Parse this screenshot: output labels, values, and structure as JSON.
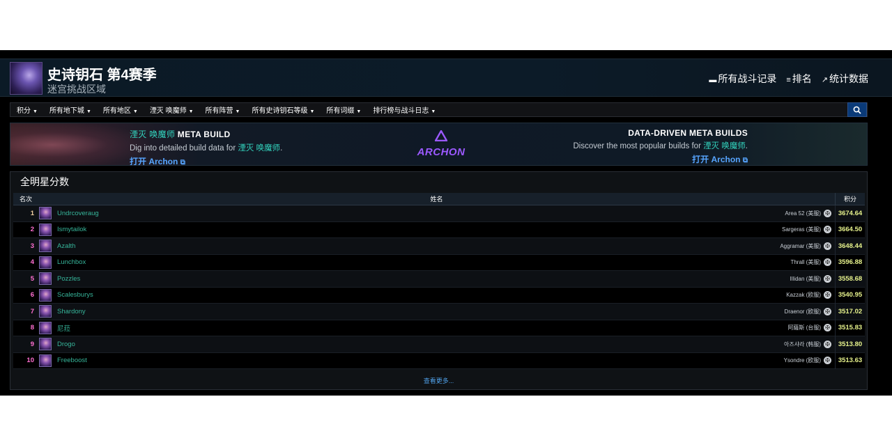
{
  "header": {
    "title": "史诗钥石 第4赛季",
    "subtitle": "迷宫挑战区域",
    "links": [
      {
        "icon": "table-icon",
        "label": "所有战斗记录"
      },
      {
        "icon": "list-icon",
        "label": "排名"
      },
      {
        "icon": "chart-icon",
        "label": "统计数据"
      }
    ]
  },
  "nav": {
    "items": [
      "积分",
      "所有地下城",
      "所有地区",
      "湮灭 唤魔师",
      "所有阵营",
      "所有史诗钥石等级",
      "所有词缀",
      "排行榜与战斗日志"
    ]
  },
  "banner": {
    "left_class": "湮灭 唤魔师",
    "left_title": "META BUILD",
    "left_desc_prefix": "Dig into detailed build data for ",
    "left_desc_class": "湮灭 唤魔师",
    "left_desc_suffix": ".",
    "left_link": "打开 Archon",
    "logo_text": "ARCHON",
    "right_title": "DATA-DRIVEN META BUILDS",
    "right_desc_prefix": "Discover the most popular builds for ",
    "right_desc_class": "湮灭 唤魔师",
    "right_desc_suffix": ".",
    "right_link": "打开 Archon"
  },
  "panel": {
    "title": "全明星分数",
    "col_rank": "名次",
    "col_name": "姓名",
    "col_score": "积分",
    "more": "查看更多..."
  },
  "rows": [
    {
      "rank": "1",
      "name": "Undrcoveraug",
      "realm": "Area 52 (美服)",
      "score": "3674.64"
    },
    {
      "rank": "2",
      "name": "Ismytailok",
      "realm": "Sargeras (美服)",
      "score": "3664.50"
    },
    {
      "rank": "3",
      "name": "Azalth",
      "realm": "Aggramar (美服)",
      "score": "3648.44"
    },
    {
      "rank": "4",
      "name": "Lunchbox",
      "realm": "Thrall (美服)",
      "score": "3596.88"
    },
    {
      "rank": "5",
      "name": "Pozzles",
      "realm": "Illidan (美服)",
      "score": "3558.68"
    },
    {
      "rank": "6",
      "name": "Scalesburys",
      "realm": "Kazzak (欧服)",
      "score": "3540.95"
    },
    {
      "rank": "7",
      "name": "Shardony",
      "realm": "Draenor (欧服)",
      "score": "3517.02"
    },
    {
      "rank": "8",
      "name": "尼菈",
      "realm": "阿薩斯 (台服)",
      "score": "3515.83"
    },
    {
      "rank": "9",
      "name": "Drogo",
      "realm": "아즈샤라 (韩服)",
      "score": "3513.80"
    },
    {
      "rank": "10",
      "name": "Freeboost",
      "realm": "Ysondre (欧服)",
      "score": "3513.63"
    }
  ],
  "colors": {
    "name": "#36b59a",
    "rank": "#ff6fd1",
    "score": "#e6f28c",
    "class": "#33d6c0",
    "link": "#57a5ff",
    "archon": "#9b59ff"
  }
}
